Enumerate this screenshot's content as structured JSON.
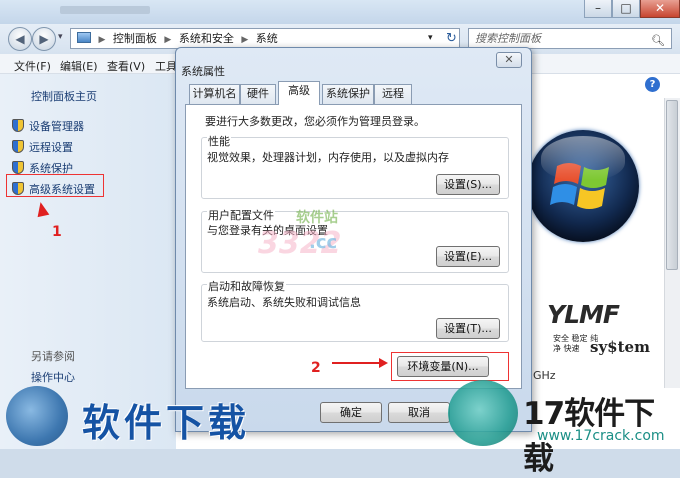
{
  "window": {
    "title_controls": {
      "minimize": "–",
      "maximize": "□",
      "close": "✕"
    },
    "nav": {
      "back": "◀",
      "forward": "▶",
      "dropdown": "▾"
    },
    "breadcrumbs": [
      "控制面板",
      "系统和安全",
      "系统"
    ],
    "breadcrumb_sep": "▶",
    "refresh": "↻",
    "search_placeholder": "搜索控制面板",
    "menu": [
      "文件(F)",
      "编辑(E)",
      "查看(V)",
      "工具"
    ]
  },
  "sidebar": {
    "home": "控制面板主页",
    "items": [
      "设备管理器",
      "远程设置",
      "系统保护",
      "高级系统设置"
    ],
    "see_also_title": "另请参阅",
    "see_also": [
      "操作中心"
    ]
  },
  "content": {
    "cpu_suffix": "GHz",
    "help": "?"
  },
  "logo": {
    "ylmf": "YLMF",
    "sub": "安全 稳定 纯净 快速",
    "system": "sy$tem"
  },
  "annotations": {
    "one": "1",
    "two": "2"
  },
  "dialog": {
    "title": "系统属性",
    "close": "✕",
    "tabs": [
      "计算机名",
      "硬件",
      "高级",
      "系统保护",
      "远程"
    ],
    "active_tab": "高级",
    "admin_note": "要进行大多数更改，您必须作为管理员登录。",
    "groups": [
      {
        "title": "性能",
        "desc": "视觉效果，处理器计划，内存使用，以及虚拟内存",
        "button": "设置(S)..."
      },
      {
        "title": "用户配置文件",
        "desc": "与您登录有关的桌面设置",
        "button": "设置(E)..."
      },
      {
        "title": "启动和故障恢复",
        "desc": "系统启动、系统失败和调试信息",
        "button": "设置(T)..."
      }
    ],
    "env_button": "环境变量(N)...",
    "ok": "确定",
    "cancel": "取消"
  },
  "watermarks": {
    "mid_small": "软件站",
    "mid_big": "3322",
    "mid_cc": ".cc",
    "left": "软件下载",
    "right": "17软件下载",
    "right_url": "www.17crack.com"
  },
  "colors": {
    "accent": "#2f6fcf",
    "annotation": "#e02020",
    "dialog_bg": "#dfe9f5"
  }
}
